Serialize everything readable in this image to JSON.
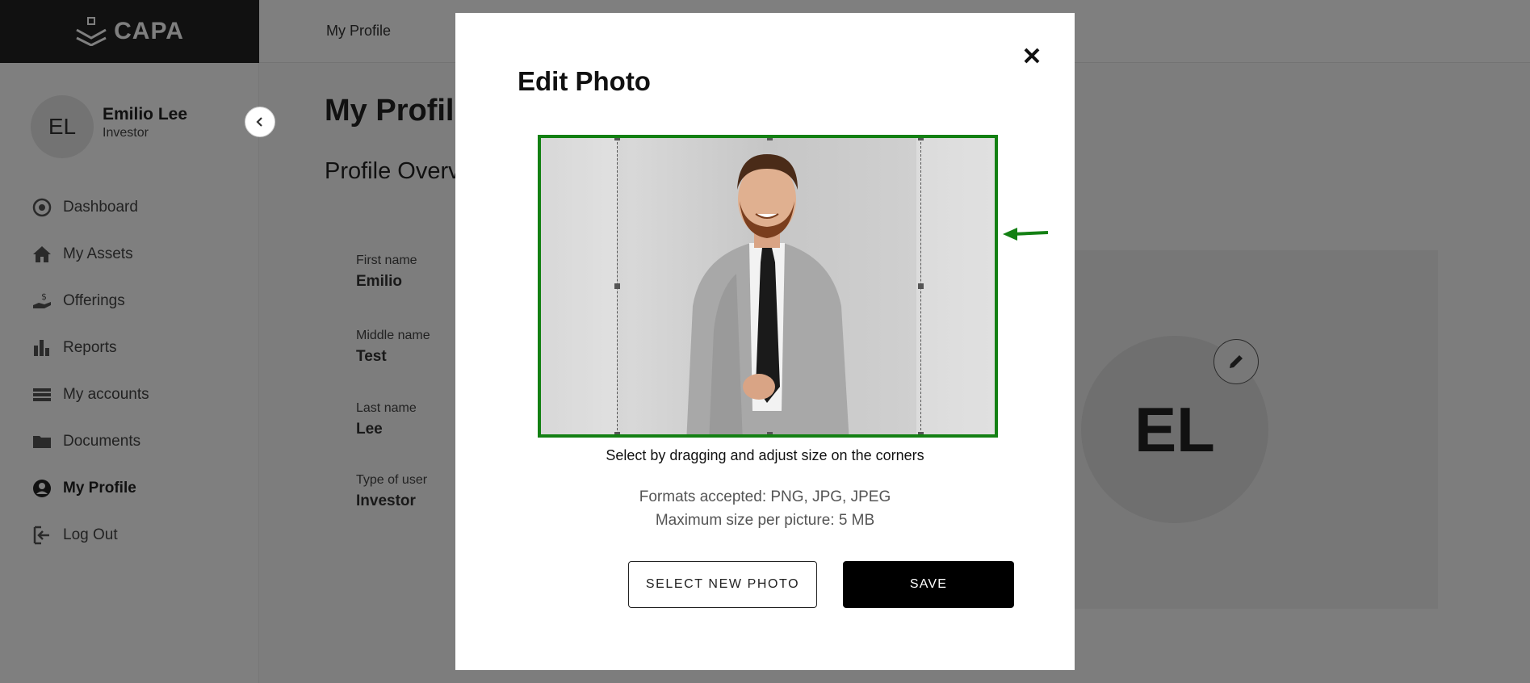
{
  "app": {
    "brand": "CAPA"
  },
  "topbar": {
    "title": "My Profile"
  },
  "user": {
    "initials": "EL",
    "name": "Emilio Lee",
    "role": "Investor"
  },
  "sidebar": {
    "items": [
      {
        "label": "Dashboard",
        "icon": "dashboard-icon"
      },
      {
        "label": "My Assets",
        "icon": "home-icon"
      },
      {
        "label": "Offerings",
        "icon": "hand-dollar-icon"
      },
      {
        "label": "Reports",
        "icon": "bar-chart-icon"
      },
      {
        "label": "My accounts",
        "icon": "list-icon"
      },
      {
        "label": "Documents",
        "icon": "folder-icon"
      },
      {
        "label": "My Profile",
        "icon": "user-circle-icon",
        "active": true
      },
      {
        "label": "Log Out",
        "icon": "logout-icon"
      }
    ]
  },
  "main": {
    "page_title": "My Profile",
    "section_title": "Profile Overview",
    "fields": [
      {
        "label": "First name",
        "value": "Emilio"
      },
      {
        "label": "Middle name",
        "value": "Test"
      },
      {
        "label": "Last name",
        "value": "Lee"
      },
      {
        "label": "Type of user",
        "value": "Investor"
      }
    ],
    "avatar_initials": "EL"
  },
  "modal": {
    "title": "Edit Photo",
    "crop_hint": "Select by dragging and adjust size on the corners",
    "formats": "Formats accepted: PNG, JPG, JPEG",
    "max_size": "Maximum size per picture: 5 MB",
    "select_button": "SELECT NEW PHOTO",
    "save_button": "SAVE"
  },
  "colors": {
    "highlight": "#138013",
    "sidebar_dark": "#222222",
    "save_bg": "#000000"
  }
}
